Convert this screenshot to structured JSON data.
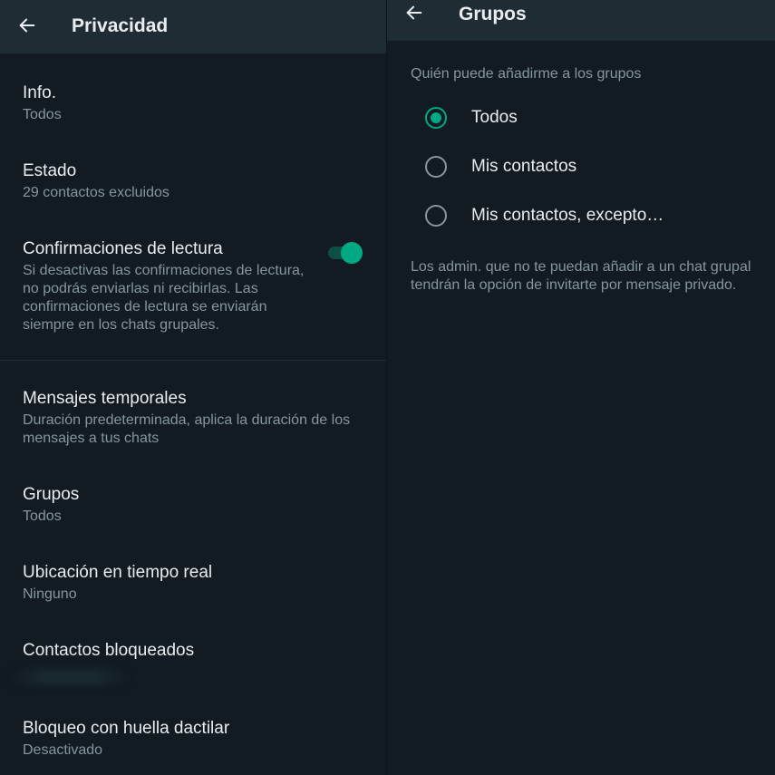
{
  "left": {
    "title": "Privacidad",
    "items": [
      {
        "title": "Info.",
        "subtitle": "Todos"
      },
      {
        "title": "Estado",
        "subtitle": "29 contactos excluidos"
      },
      {
        "title": "Confirmaciones de lectura",
        "subtitle": "Si desactivas las confirmaciones de lectura, no podrás enviarlas ni recibirlas. Las confirmaciones de lectura se enviarán siempre en los chats grupales."
      },
      {
        "title": "Mensajes temporales",
        "subtitle": "Duración predeterminada, aplica la duración de los mensajes a tus chats"
      },
      {
        "title": "Grupos",
        "subtitle": "Todos"
      },
      {
        "title": "Ubicación en tiempo real",
        "subtitle": "Ninguno"
      },
      {
        "title": "Contactos bloqueados"
      },
      {
        "title": "Bloqueo con huella dactilar",
        "subtitle": "Desactivado"
      }
    ],
    "read_receipts_enabled": true
  },
  "right": {
    "title": "Grupos",
    "section_label": "Quién puede añadirme a los grupos",
    "options": [
      {
        "label": "Todos",
        "selected": true
      },
      {
        "label": "Mis contactos",
        "selected": false
      },
      {
        "label": "Mis contactos, excepto…",
        "selected": false
      }
    ],
    "note": "Los admin. que no te puedan añadir a un chat grupal tendrán la opción de invitarte por mensaje privado."
  },
  "colors": {
    "background": "#111b21",
    "appbar": "#202c33",
    "accent": "#00a884",
    "primary_text": "#e9edef",
    "secondary_text": "#8696a0"
  },
  "icons": {
    "back": "arrow-left-icon"
  }
}
